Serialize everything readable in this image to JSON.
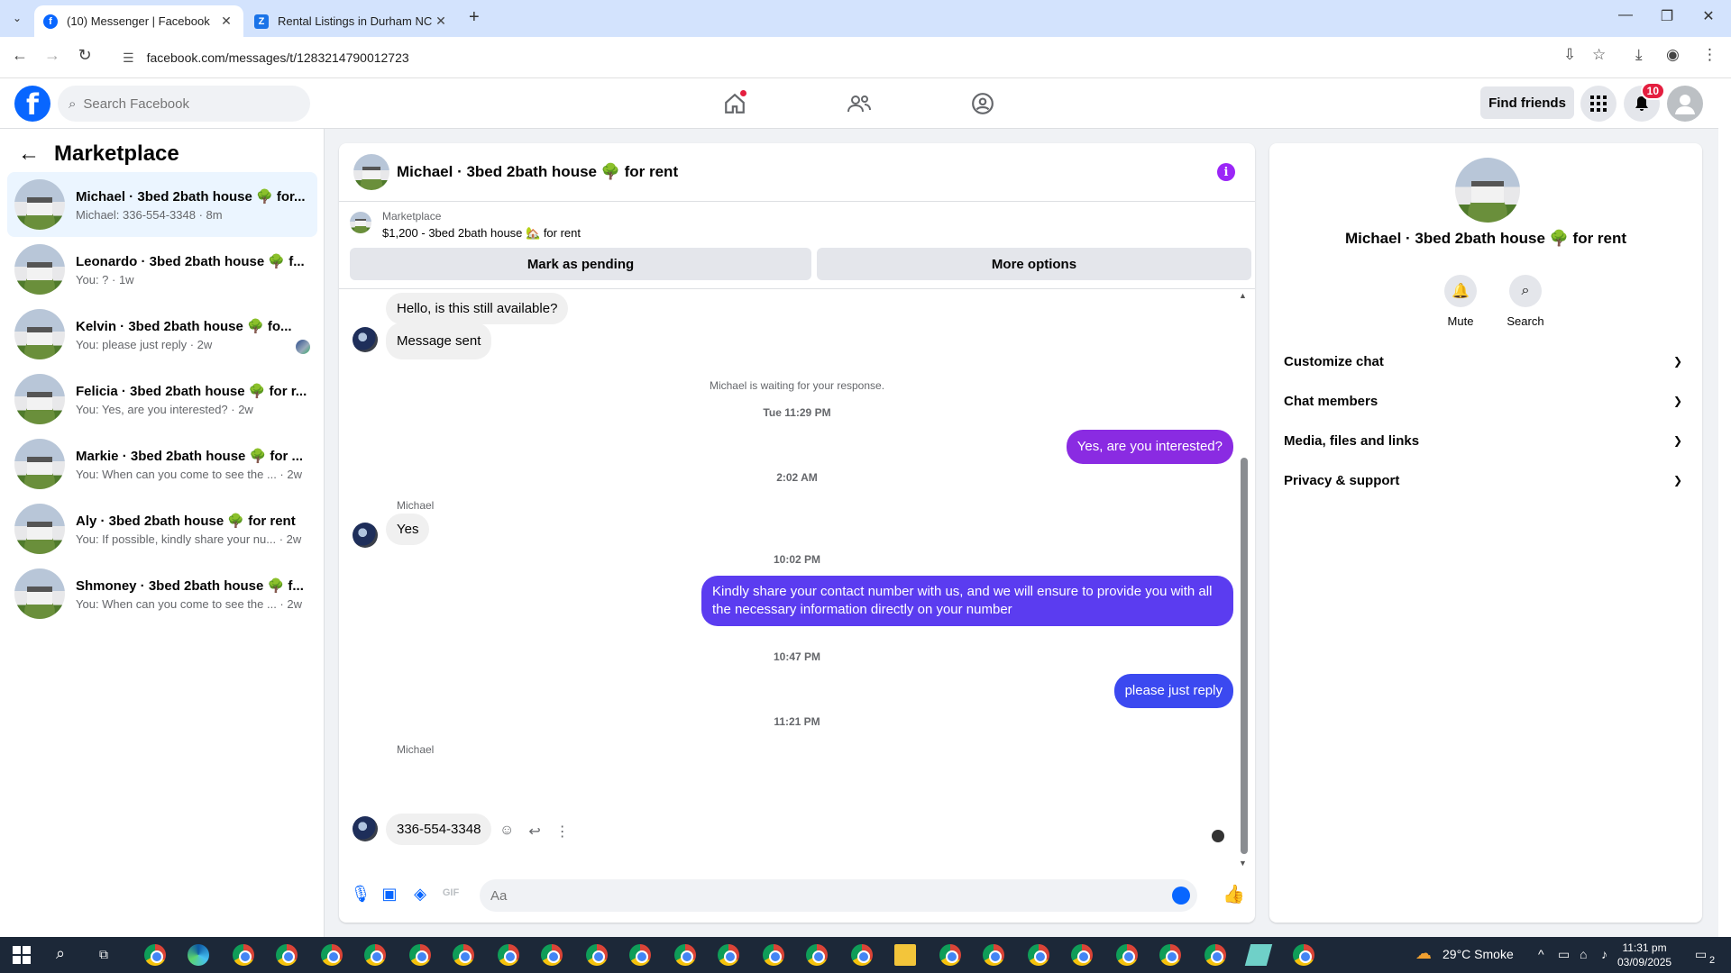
{
  "browser": {
    "tabs": [
      {
        "title": "(10) Messenger | Facebook",
        "active": true
      },
      {
        "title": "Rental Listings in Durham NC -",
        "active": false
      }
    ],
    "url": "facebook.com/messages/t/1283214790012723"
  },
  "fb_nav": {
    "search_placeholder": "Search Facebook",
    "find_friends": "Find friends",
    "notification_count": "10"
  },
  "left_panel": {
    "title": "Marketplace",
    "conversations": [
      {
        "name": "Michael · 3bed 2bath house 🌳 for...",
        "preview": "Michael: 336-554-3348 · 8m"
      },
      {
        "name": "Leonardo · 3bed 2bath house 🌳 f...",
        "preview": "You: ? · 1w"
      },
      {
        "name": "Kelvin · 3bed 2bath house 🌳 fo...",
        "preview": "You: please just reply · 2w"
      },
      {
        "name": "Felicia · 3bed 2bath house 🌳 for r...",
        "preview": "You: Yes, are you interested? · 2w"
      },
      {
        "name": "Markie · 3bed 2bath house 🌳 for ...",
        "preview": "You: When can you come to see the ... · 2w"
      },
      {
        "name": "Aly · 3bed 2bath house 🌳 for rent",
        "preview": "You: If possible, kindly share your nu... · 2w"
      },
      {
        "name": "Shmoney · 3bed 2bath house 🌳 f...",
        "preview": "You: When can you come to see the ... · 2w"
      }
    ]
  },
  "chat": {
    "title": "Michael · 3bed 2bath house 🌳 for rent",
    "listing_label": "Marketplace",
    "listing_price": "$1,200 - 3bed 2bath house 🏡 for rent",
    "mark_pending": "Mark as pending",
    "more_options": "More options",
    "messages": {
      "m1": "Hello, is this still available?",
      "m2": "Message sent",
      "waiting": "Michael is waiting for your response.",
      "ts1": "Tue 11:29 PM",
      "m3": "Yes, are you interested?",
      "ts2": "2:02 AM",
      "sender1": "Michael",
      "m4": "Yes",
      "ts3": "10:02 PM",
      "m5": "Kindly share your contact number with us, and we will ensure to provide you with all the necessary information directly on your number",
      "ts4": "10:47 PM",
      "m6": "please just reply",
      "ts5": "11:21 PM",
      "sender2": "Michael",
      "m7": "336-554-3348"
    },
    "composer_placeholder": "Aa"
  },
  "right_panel": {
    "title": "Michael · 3bed 2bath house 🌳 for rent",
    "mute": "Mute",
    "search": "Search",
    "sections": [
      "Customize chat",
      "Chat members",
      "Media, files and links",
      "Privacy & support"
    ]
  },
  "taskbar": {
    "weather": "29°C  Smoke",
    "time": "11:31 pm",
    "date": "03/09/2025",
    "notifications": "2"
  },
  "colors": {
    "fb_blue": "#0866ff",
    "bubble_purple": "#8a2be2",
    "bubble_indigo": "#5b3cf0",
    "bubble_blue": "#3b49f0"
  }
}
